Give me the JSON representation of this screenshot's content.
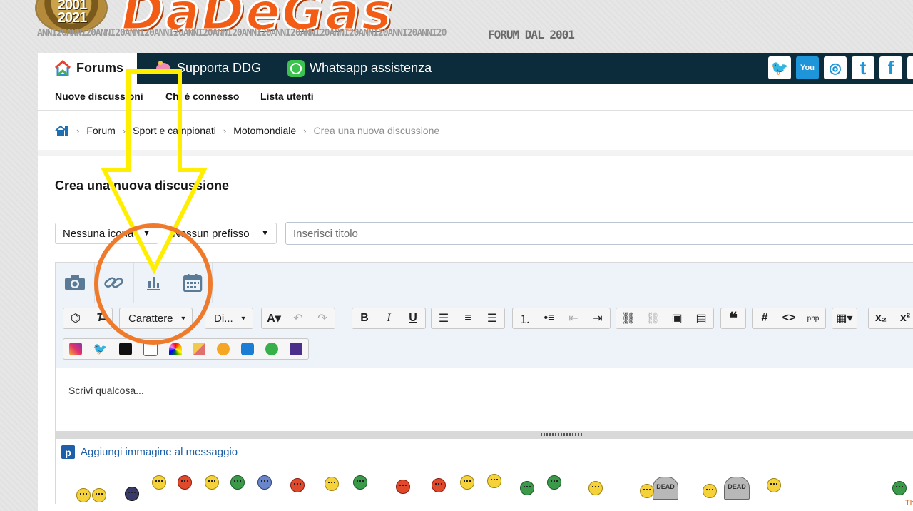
{
  "banner": {
    "seal_line1": "2001",
    "seal_line2": "2021",
    "logo": "DaDeGas",
    "anni_strip": "ANNI20ANNI20ANNI20ANNI20ANNI20ANNI20ANNI20ANNI20ANNI20ANNI20ANNI20ANNI20ANNI20ANNI20",
    "tagline": "FORUM DAL 2001"
  },
  "navbar": {
    "tabs": [
      {
        "label": "Forums",
        "icon": "home-icon"
      },
      {
        "label": "Supporta DDG",
        "icon": "piggy-bank-icon"
      },
      {
        "label": "Whatsapp assistenza",
        "icon": "whatsapp-icon"
      }
    ],
    "social": [
      {
        "name": "twitter",
        "glyph": "🐦"
      },
      {
        "name": "youtube",
        "glyph": "You"
      },
      {
        "name": "instagram",
        "glyph": "◎"
      },
      {
        "name": "tumblr",
        "glyph": "t"
      },
      {
        "name": "facebook",
        "glyph": "f"
      }
    ]
  },
  "subnav": {
    "new_posts": "Nuove discussioni",
    "whos_online": "Chi è connesso",
    "members": "Lista utenti"
  },
  "breadcrumb": {
    "items": [
      "Forum",
      "Sport e campionati",
      "Motomondiale"
    ],
    "current": "Crea una nuova discussione"
  },
  "page_title": "Crea una nuova discussione",
  "form": {
    "icon_select": "Nessuna icona",
    "prefix_select": "Nessun prefisso",
    "title_placeholder": "Inserisci titolo"
  },
  "editor": {
    "attach_buttons": [
      "camera-icon",
      "link-icon",
      "poll-icon",
      "calendar-icon"
    ],
    "font_label": "Carattere",
    "size_label": "Di...",
    "placeholder": "Scrivi qualcosa...",
    "add_image": "Aggiungi immagine al messaggio",
    "thank_label": "Thank"
  },
  "annotations": {
    "arrow_color": "#ffee00",
    "circle_color": "#f07a2c"
  }
}
